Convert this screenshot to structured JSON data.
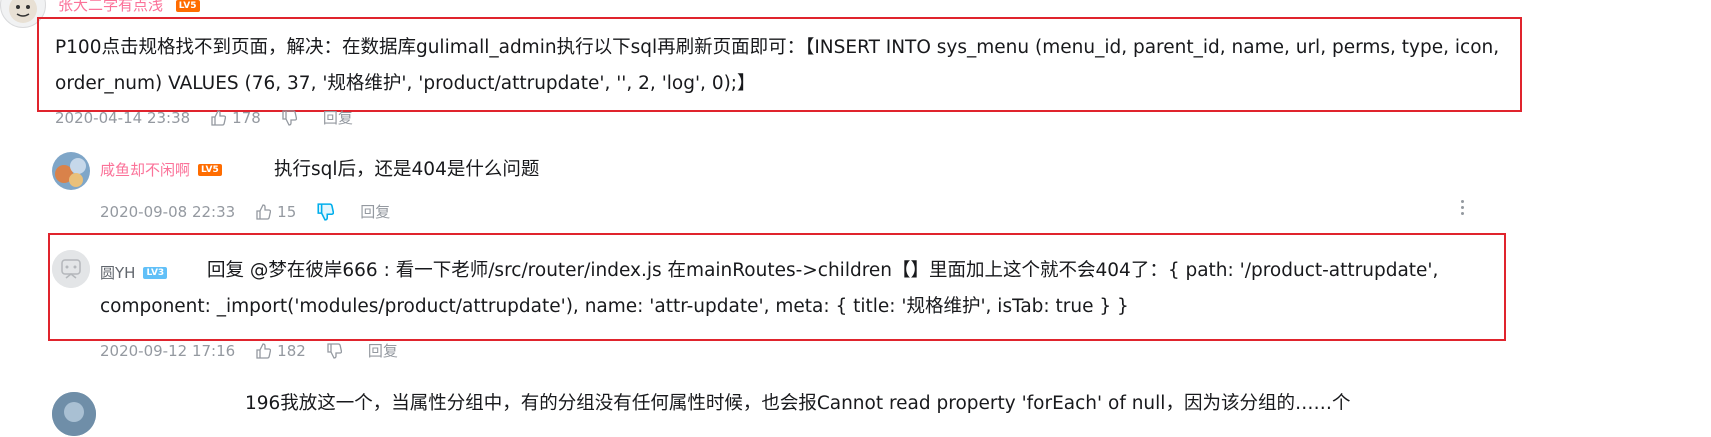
{
  "top_comment": {
    "username": "张大二学有点浅",
    "level": "LV5",
    "text": "P100点击规格找不到页面，解决：在数据库gulimall_admin执行以下sql再刷新页面即可：【INSERT INTO sys_menu (menu_id, parent_id, name, url, perms, type, icon, order_num) VALUES (76, 37, '规格维护', 'product/attrupdate', '', 2, 'log', 0);】",
    "date": "2020-04-14 23:38",
    "likes": "178",
    "reply_label": "回复"
  },
  "replies": [
    {
      "username": "咸鱼却不闲啊",
      "level": "LV5",
      "text": "执行sql后，还是404是什么问题",
      "date": "2020-09-08 22:33",
      "likes": "15",
      "reply_label": "回复"
    },
    {
      "username": "圆YH",
      "level": "LV3",
      "reply_prefix": "回复 @梦在彼岸666 :",
      "text": "看一下老师/src/router/index.js 在mainRoutes->children【】里面加上这个就不会404了：{ path: '/product-attrupdate', component: _import('modules/product/attrupdate'), name: 'attr-update', meta: { title: '规格维护', isTab: true } }",
      "date": "2020-09-12 17:16",
      "likes": "182",
      "reply_label": "回复"
    }
  ],
  "next_comment": {
    "text_fragment": "196我放这一个，当属性分组中，有的分组没有任何属性时候，也会报Cannot read property 'forEach' of null，因为该分组的……个"
  },
  "colors": {
    "pink_name": "#fb7299",
    "blue_name": "#00aeec",
    "meta_gray": "#9499a0",
    "highlight_box": "#e0242d",
    "lv5_badge": "#ff6c00",
    "lv3_badge": "#61c0f8"
  }
}
